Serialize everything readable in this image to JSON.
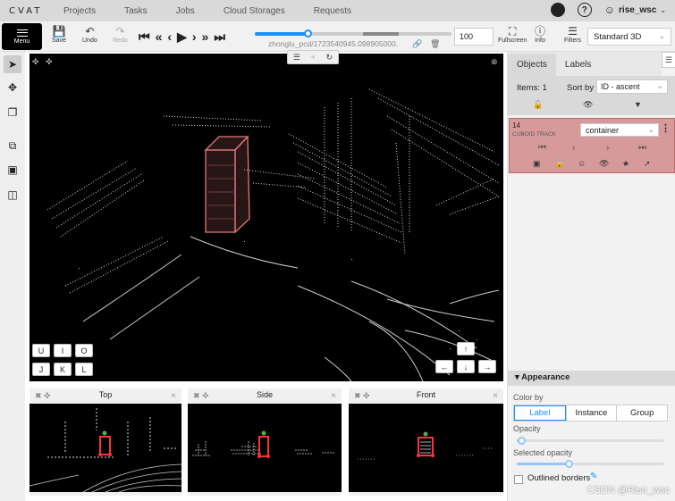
{
  "topnav": {
    "logo": "CVAT",
    "items": [
      "Projects",
      "Tasks",
      "Jobs",
      "Cloud Storages",
      "Requests"
    ],
    "help": "?",
    "user": "rise_wsc"
  },
  "toolbar": {
    "menu_label": "Menu",
    "save_label": "Save",
    "undo_label": "Undo",
    "redo_label": "Redo",
    "filename": "zhonglu_pcd/1723540945.098905000.",
    "frame": "100",
    "frame_progress": 0.27,
    "fullscreen_label": "Fullscreen",
    "info_label": "Info",
    "filters_label": "Filters",
    "workspace": "Standard 3D"
  },
  "keypad": {
    "row1": [
      "U",
      "I",
      "O"
    ],
    "row2": [
      "J",
      "K",
      "L"
    ]
  },
  "views": {
    "top": "Top",
    "side": "Side",
    "front": "Front"
  },
  "sidebar": {
    "tabs": [
      "Objects",
      "Labels"
    ],
    "items_count": "Items: 1",
    "sort_by_label": "Sort by",
    "sort_by_value": "ID - ascent",
    "object": {
      "id": "14",
      "type": "CUBOID TRACK",
      "label": "container"
    },
    "appearance": {
      "title": "Appearance",
      "color_by_label": "Color by",
      "color_by_options": [
        "Label",
        "Instance",
        "Group"
      ],
      "opacity_label": "Opacity",
      "opacity_value": 0.03,
      "selected_opacity_label": "Selected opacity",
      "selected_opacity_value": 0.35,
      "outlined_borders_label": "Outlined borders"
    }
  },
  "watermark": "CSDN @Rise_wsc",
  "colors": {
    "accent": "#1890ff",
    "object_card": "#d79a9a",
    "cuboid": "#e07a7a"
  }
}
